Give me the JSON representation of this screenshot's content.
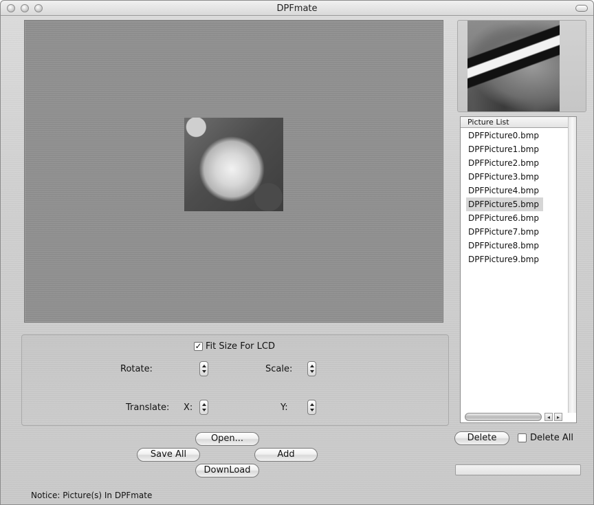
{
  "window": {
    "title": "DPFmate"
  },
  "controls": {
    "fit_size_label": "Fit Size For LCD",
    "fit_size_checked": true,
    "check_glyph": "✓",
    "rotate_label": "Rotate:",
    "scale_label": "Scale:",
    "translate_label": "Translate:",
    "x_label": "X:",
    "y_label": "Y:"
  },
  "buttons": {
    "open": "Open...",
    "save_all": "Save All",
    "add": "Add",
    "download": "DownLoad",
    "delete": "Delete"
  },
  "picture_list": {
    "header": "Picture List",
    "items": [
      "DPFPicture0.bmp",
      "DPFPicture1.bmp",
      "DPFPicture2.bmp",
      "DPFPicture3.bmp",
      "DPFPicture4.bmp",
      "DPFPicture5.bmp",
      "DPFPicture6.bmp",
      "DPFPicture7.bmp",
      "DPFPicture8.bmp",
      "DPFPicture9.bmp"
    ],
    "selected_index": 5
  },
  "delete_all": {
    "label": "Delete All",
    "checked": false
  },
  "status": {
    "notice": "Notice: Picture(s) In DPFmate"
  },
  "icons": {
    "scroll_left": "◂",
    "scroll_right": "▸"
  }
}
